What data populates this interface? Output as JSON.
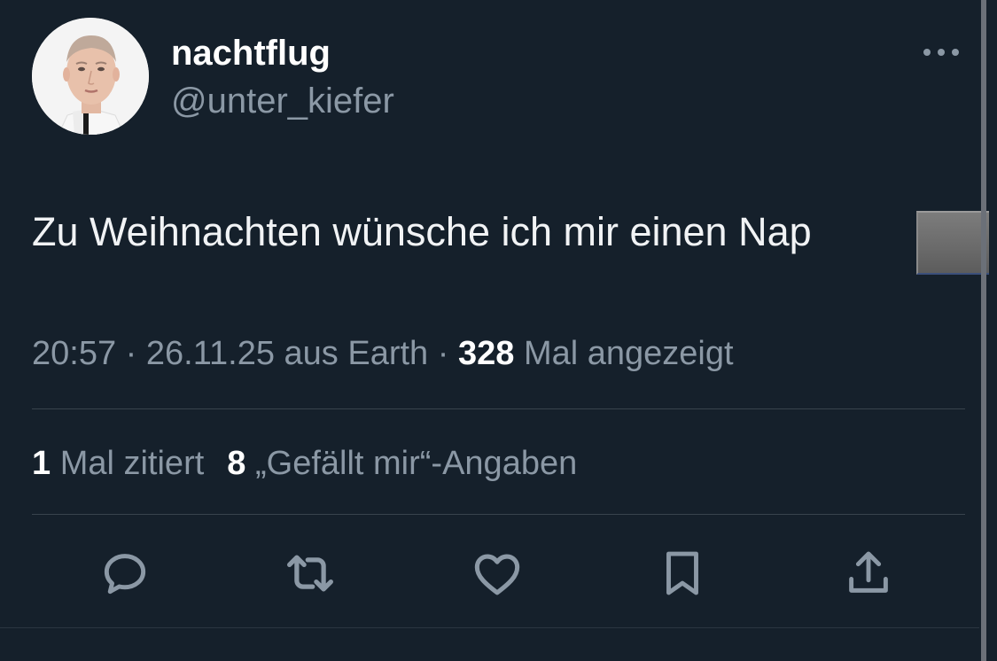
{
  "author": {
    "display_name": "nachtflug",
    "handle": "@unter_kiefer"
  },
  "tweet": {
    "text": "Zu Weihnachten wünsche ich mir einen Nap"
  },
  "meta": {
    "time": "20:57",
    "sep1": " · ",
    "date": "26.11.25",
    "source": " aus Earth",
    "sep2": " · ",
    "views_count": "328",
    "views_label": " Mal angezeigt"
  },
  "stats": {
    "quotes_count": "1",
    "quotes_label": " Mal zitiert",
    "likes_count": "8",
    "likes_label": " „Gefällt mir“-Angaben"
  },
  "actions": {
    "icons": [
      "reply-icon",
      "retweet-icon",
      "like-icon",
      "bookmark-icon",
      "share-icon"
    ]
  },
  "colors": {
    "background": "#15202b",
    "text_primary": "#ffffff",
    "text_secondary": "#8b98a5",
    "divider": "#38444d"
  }
}
